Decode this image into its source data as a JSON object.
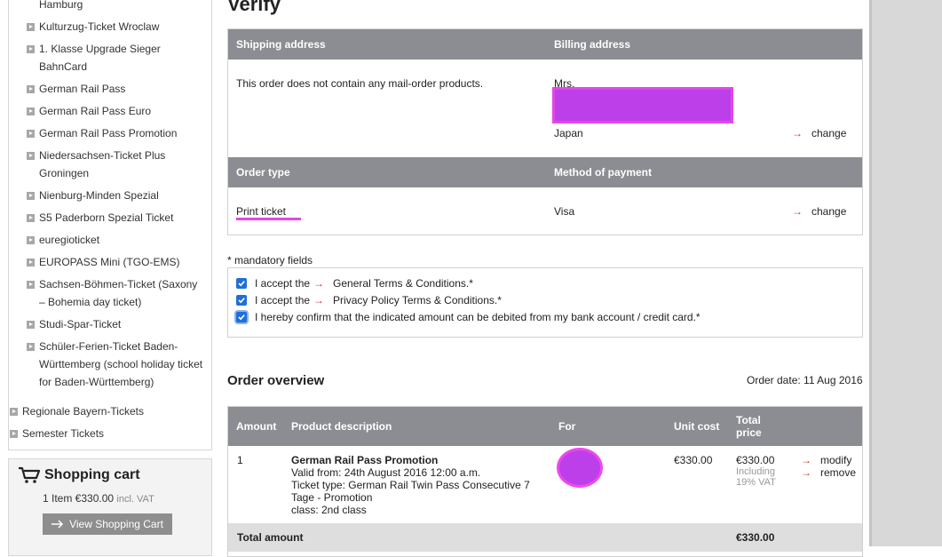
{
  "sidebar": {
    "items": [
      {
        "label": "Hamburg",
        "indent": "sub",
        "bullet": false
      },
      {
        "label": "Kulturzug-Ticket Wroclaw",
        "indent": "sub",
        "bullet": true
      },
      {
        "label": "1. Klasse Upgrade Sieger BahnCard",
        "indent": "sub",
        "bullet": true
      },
      {
        "label": "German Rail Pass",
        "indent": "sub",
        "bullet": true
      },
      {
        "label": "German Rail Pass Euro",
        "indent": "sub",
        "bullet": true
      },
      {
        "label": "German Rail Pass Promotion",
        "indent": "sub",
        "bullet": true
      },
      {
        "label": "Niedersachsen-Ticket Plus Groningen",
        "indent": "sub",
        "bullet": true
      },
      {
        "label": "Nienburg-Minden Spezial",
        "indent": "sub",
        "bullet": true
      },
      {
        "label": "S5 Paderborn Spezial Ticket",
        "indent": "sub",
        "bullet": true
      },
      {
        "label": "euregioticket",
        "indent": "sub",
        "bullet": true
      },
      {
        "label": "EUROPASS Mini (TGO-EMS)",
        "indent": "sub",
        "bullet": true
      },
      {
        "label": "Sachsen-Böhmen-Ticket (Saxony – Bohemia day ticket)",
        "indent": "sub",
        "bullet": true
      },
      {
        "label": "Studi-Spar-Ticket",
        "indent": "sub",
        "bullet": true
      },
      {
        "label": "Schüler-Ferien-Ticket Baden-Württemberg (school holiday ticket for Baden-Württemberg)",
        "indent": "sub",
        "bullet": true
      },
      {
        "label": "Regionale Bayern-Tickets",
        "indent": "top",
        "bullet": true
      },
      {
        "label": "Semester Tickets",
        "indent": "top",
        "bullet": true
      }
    ]
  },
  "cart": {
    "title": "Shopping cart",
    "summary": "1 Item €330.00",
    "vat_note": "incl. VAT",
    "button": "View Shopping Cart"
  },
  "main": {
    "title": "Verify",
    "shipping_header": "Shipping address",
    "billing_header": "Billing address",
    "shipping_text": "This order does not contain any mail-order products.",
    "billing_salutation": "Mrs.",
    "billing_country": "Japan",
    "change_label": "change",
    "order_type_header": "Order type",
    "payment_header": "Method of payment",
    "order_type_value": "Print ticket",
    "payment_value": "Visa"
  },
  "terms": {
    "mandatory_note": "* mandatory fields",
    "items": [
      {
        "prefix": "I accept the",
        "link": "General Terms & Conditions.*",
        "checked": true
      },
      {
        "prefix": "I accept the",
        "link": "Privacy Policy Terms & Conditions.*",
        "checked": true
      },
      {
        "prefix": "I hereby confirm that the indicated amount can be debited from my bank account / credit card.*",
        "link": "",
        "checked": true
      }
    ]
  },
  "overview": {
    "title": "Order overview",
    "order_date": "Order date: 11 Aug 2016",
    "columns": [
      "Amount",
      "Product description",
      "For",
      "Unit cost",
      "Total price"
    ],
    "row": {
      "amount": "1",
      "product_name": "German Rail Pass Promotion",
      "valid_from": "Valid from: 24th August 2016 12:00 a.m.",
      "ticket_type": "Ticket type: German Rail Twin Pass Consecutive 7",
      "ticket_type_cont": "Tage - Promotion",
      "class": "class: 2nd class",
      "unit_cost": "€330.00",
      "total_price": "€330.00",
      "vat_line1": "Including",
      "vat_line2": "19% VAT",
      "modify": "modify",
      "remove": "remove"
    },
    "total_label": "Total amount",
    "total_value": "€330.00"
  },
  "colors": {
    "header_band": "#8b8d92",
    "link_arrow": "#c0392b",
    "checkbox": "#1f6fd8",
    "redaction": "#bd3fe9"
  }
}
